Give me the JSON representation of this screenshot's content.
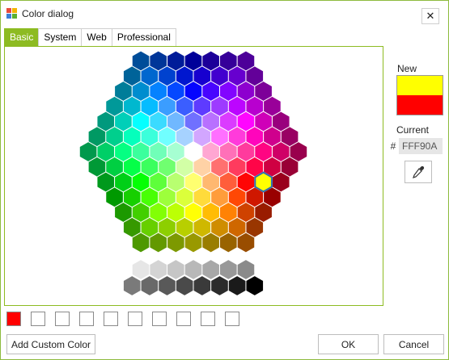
{
  "window": {
    "title": "Color dialog",
    "close_glyph": "✕"
  },
  "tabs": [
    {
      "label": "Basic",
      "active": true
    },
    {
      "label": "System",
      "active": false
    },
    {
      "label": "Web",
      "active": false
    },
    {
      "label": "Professional",
      "active": false
    }
  ],
  "palette": {
    "selected_color": "#FFFF00",
    "grayscale": [
      "#e6e6e6",
      "#d4d4d4",
      "#c6c6c6",
      "#b8b8b8",
      "#a8a8a8",
      "#989898",
      "#8a8a8a",
      "#7a7a7a",
      "#696969",
      "#595959",
      "#4a4a4a",
      "#3a3a3a",
      "#2b2b2b",
      "#1a1a1a",
      "#000000"
    ]
  },
  "preview": {
    "new_label": "New",
    "new_color": "#FFFF00",
    "current_label": "Current",
    "current_color": "#FF0000"
  },
  "hex": {
    "prefix": "#",
    "value": "FFF90A"
  },
  "eyedropper_icon": "eyedropper-icon",
  "custom_colors": [
    "#FF0000",
    "",
    "",
    "",
    "",
    "",
    "",
    "",
    "",
    ""
  ],
  "buttons": {
    "add_custom": "Add Custom Color",
    "ok": "OK",
    "cancel": "Cancel"
  }
}
